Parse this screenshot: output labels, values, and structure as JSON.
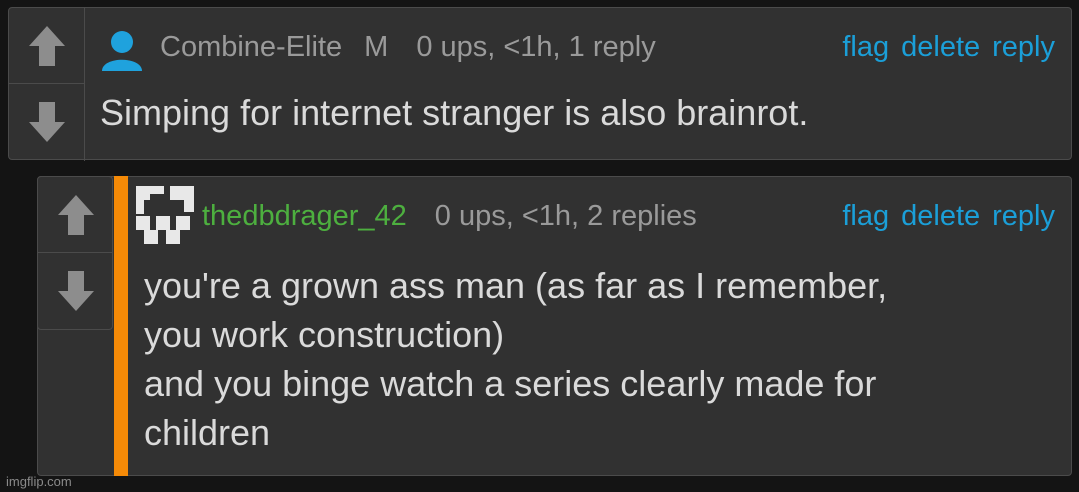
{
  "comments": [
    {
      "username": "Combine-Elite",
      "badge": "M",
      "stats": "0 ups, <1h, 1 reply",
      "flag": "flag",
      "delete": "delete",
      "reply": "reply",
      "text": "Simping for internet stranger is also brainrot."
    },
    {
      "username": "thedbdrager_42",
      "stats": "0 ups, <1h, 2 replies",
      "flag": "flag",
      "delete": "delete",
      "reply": "reply",
      "text": "you're a grown ass man (as far as I remember,\nyou work construction)\nand you binge watch a series clearly made for\nchildren"
    }
  ],
  "watermark": "imgflip.com",
  "colors": {
    "background": "#141414",
    "card": "#313131",
    "link": "#1b9fd8",
    "username_green": "#4daf3f",
    "accent": "#f58a07",
    "avatar_blue": "#1fa2dd"
  }
}
